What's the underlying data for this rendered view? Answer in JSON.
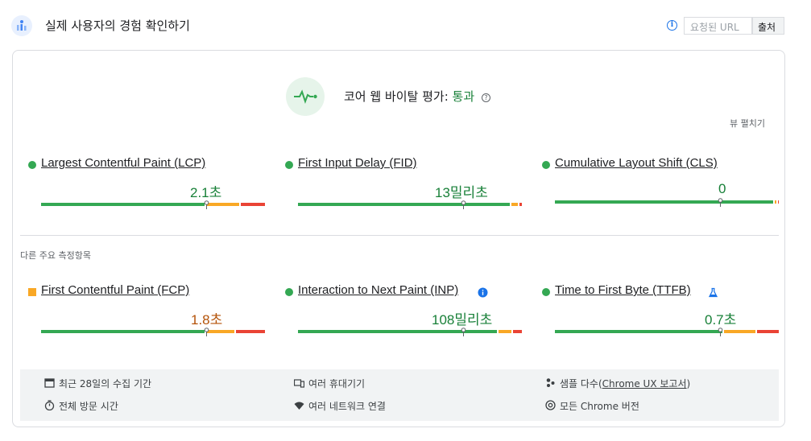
{
  "header": {
    "title": "실제 사용자의 경험 확인하기",
    "url_tab": "요청된 URL",
    "origin_tab": "출처"
  },
  "assessment": {
    "label": "코어 웹 바이탈 평가:",
    "result": "통과",
    "help_glyph": "?",
    "expand_label": "뷰 펼치기"
  },
  "core_metrics": [
    {
      "name": "Largest Contentful Paint (LCP)",
      "value": "2.1초",
      "status": "good",
      "marker_percent": 74,
      "dist": [
        74,
        15,
        11
      ]
    },
    {
      "name": "First Input Delay (FID)",
      "value": "13밀리초",
      "status": "good",
      "marker_percent": 74,
      "dist": [
        96,
        3,
        1
      ]
    },
    {
      "name": "Cumulative Layout Shift (CLS)",
      "value": "0",
      "status": "good",
      "marker_percent": 74,
      "dist": [
        99,
        0.5,
        0.5
      ]
    }
  ],
  "other_section_label": "다른 주요 측정항목",
  "other_metrics": [
    {
      "name": "First Contentful Paint (FCP)",
      "value": "1.8초",
      "status": "needs-improvement",
      "marker_percent": 74,
      "dist": [
        74,
        13,
        13
      ],
      "extra_icon": ""
    },
    {
      "name": "Interaction to Next Paint (INP)",
      "value": "108밀리초",
      "status": "good",
      "marker_percent": 74,
      "dist": [
        90,
        6,
        4
      ],
      "extra_icon": "info-icon"
    },
    {
      "name": "Time to First Byte (TTFB)",
      "value": "0.7초",
      "status": "good",
      "marker_percent": 74,
      "dist": [
        76,
        14,
        10
      ],
      "extra_icon": "flask-icon"
    }
  ],
  "footer": {
    "collection_period": "최근 28일의 수집 기간",
    "devices": "여러 휴대기기",
    "samples_prefix": "샘플 다수(",
    "samples_link": "Chrome UX 보고서",
    "samples_suffix": ")",
    "visit_duration": "전체 방문 시간",
    "network": "여러 네트워크 연결",
    "chrome_versions": "모든 Chrome 버전"
  },
  "colors": {
    "good": "#34a853",
    "needs_improvement": "#f9a825",
    "poor": "#ea4335",
    "accent": "#1a73e8"
  }
}
